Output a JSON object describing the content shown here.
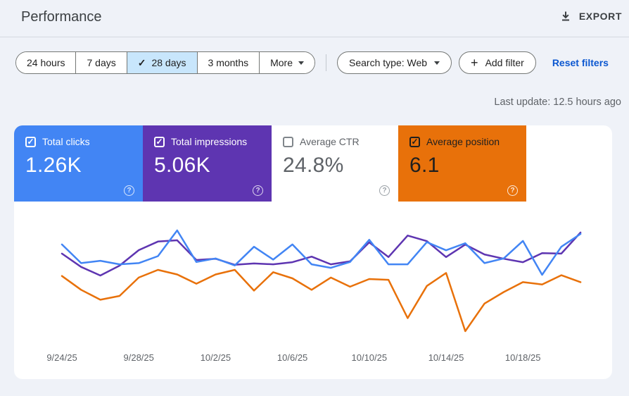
{
  "page": {
    "title": "Performance",
    "export_label": "EXPORT",
    "last_update": "Last update: 12.5 hours ago"
  },
  "icons": {
    "check": "✓",
    "plus": "+",
    "help": "?"
  },
  "filters": {
    "selected_bg": "#c8e6fc",
    "date_ranges": [
      {
        "label": "24 hours",
        "selected": false
      },
      {
        "label": "7 days",
        "selected": false
      },
      {
        "label": "28 days",
        "selected": true
      },
      {
        "label": "3 months",
        "selected": false
      }
    ],
    "more_label": "More",
    "search_type": "Search type: Web",
    "add_filter": "Add filter",
    "reset_filters": "Reset filters"
  },
  "metrics": [
    {
      "label": "Total clicks",
      "value": "1.26K",
      "checked": true,
      "bg": "#4285f4",
      "label_color": "#ffffff",
      "value_color": "#ffffff",
      "box_color": "#ffffff",
      "help_color": "rgba(255,255,255,0.8)"
    },
    {
      "label": "Total impressions",
      "value": "5.06K",
      "checked": true,
      "bg": "#5e35b1",
      "label_color": "#ffffff",
      "value_color": "#ffffff",
      "box_color": "#ffffff",
      "help_color": "rgba(255,255,255,0.8)"
    },
    {
      "label": "Average CTR",
      "value": "24.8%",
      "checked": false,
      "bg": "#ffffff",
      "label_color": "#5f6368",
      "value_color": "#5f6368",
      "box_color": "#80868b",
      "help_color": "#9aa0a6"
    },
    {
      "label": "Average position",
      "value": "6.1",
      "checked": true,
      "bg": "#e8710a",
      "label_color": "#1f1f1f",
      "value_color": "#1f1f1f",
      "box_color": "#1f1f1f",
      "help_color": "rgba(255,255,255,0.85)"
    }
  ],
  "chart_data": {
    "type": "line",
    "grid": false,
    "legend_position": "none",
    "x": [
      "9/24/25",
      "9/25/25",
      "9/26/25",
      "9/27/25",
      "9/28/25",
      "9/29/25",
      "9/30/25",
      "10/1/25",
      "10/2/25",
      "10/3/25",
      "10/4/25",
      "10/5/25",
      "10/6/25",
      "10/7/25",
      "10/8/25",
      "10/9/25",
      "10/10/25",
      "10/11/25",
      "10/12/25",
      "10/13/25",
      "10/14/25",
      "10/15/25",
      "10/16/25",
      "10/17/25",
      "10/18/25",
      "10/19/25",
      "10/20/25",
      "10/21/25"
    ],
    "x_tick_labels": [
      "9/24/25",
      "9/28/25",
      "10/2/25",
      "10/6/25",
      "10/10/25",
      "10/14/25",
      "10/18/25"
    ],
    "series": [
      {
        "name": "Total clicks",
        "color": "#4285f4",
        "total_displayed": "1.26K",
        "values": [
          54,
          38,
          40,
          37,
          38,
          44,
          66,
          39,
          42,
          36,
          52,
          41,
          54,
          37,
          34,
          39,
          58,
          37,
          37,
          56,
          49,
          55,
          38,
          42,
          57,
          28,
          52,
          63
        ]
      },
      {
        "name": "Total impressions",
        "color": "#5e35b1",
        "total_displayed": "5.06K",
        "values": [
          191,
          160,
          140,
          163,
          199,
          219,
          222,
          176,
          179,
          165,
          168,
          166,
          171,
          184,
          166,
          173,
          217,
          183,
          233,
          220,
          183,
          212,
          189,
          179,
          171,
          192,
          191,
          240
        ]
      },
      {
        "name": "Average position",
        "color": "#e8710a",
        "average_displayed": "6.1",
        "axis_inverted": true,
        "values": [
          4.8,
          6.6,
          7.9,
          7.4,
          5.0,
          4.0,
          4.6,
          5.8,
          4.6,
          4.0,
          6.7,
          4.3,
          5.1,
          6.6,
          5.0,
          6.2,
          5.2,
          5.3,
          10.3,
          6.1,
          4.4,
          12.0,
          8.4,
          6.9,
          5.6,
          5.9,
          4.7,
          5.6
        ]
      }
    ]
  }
}
